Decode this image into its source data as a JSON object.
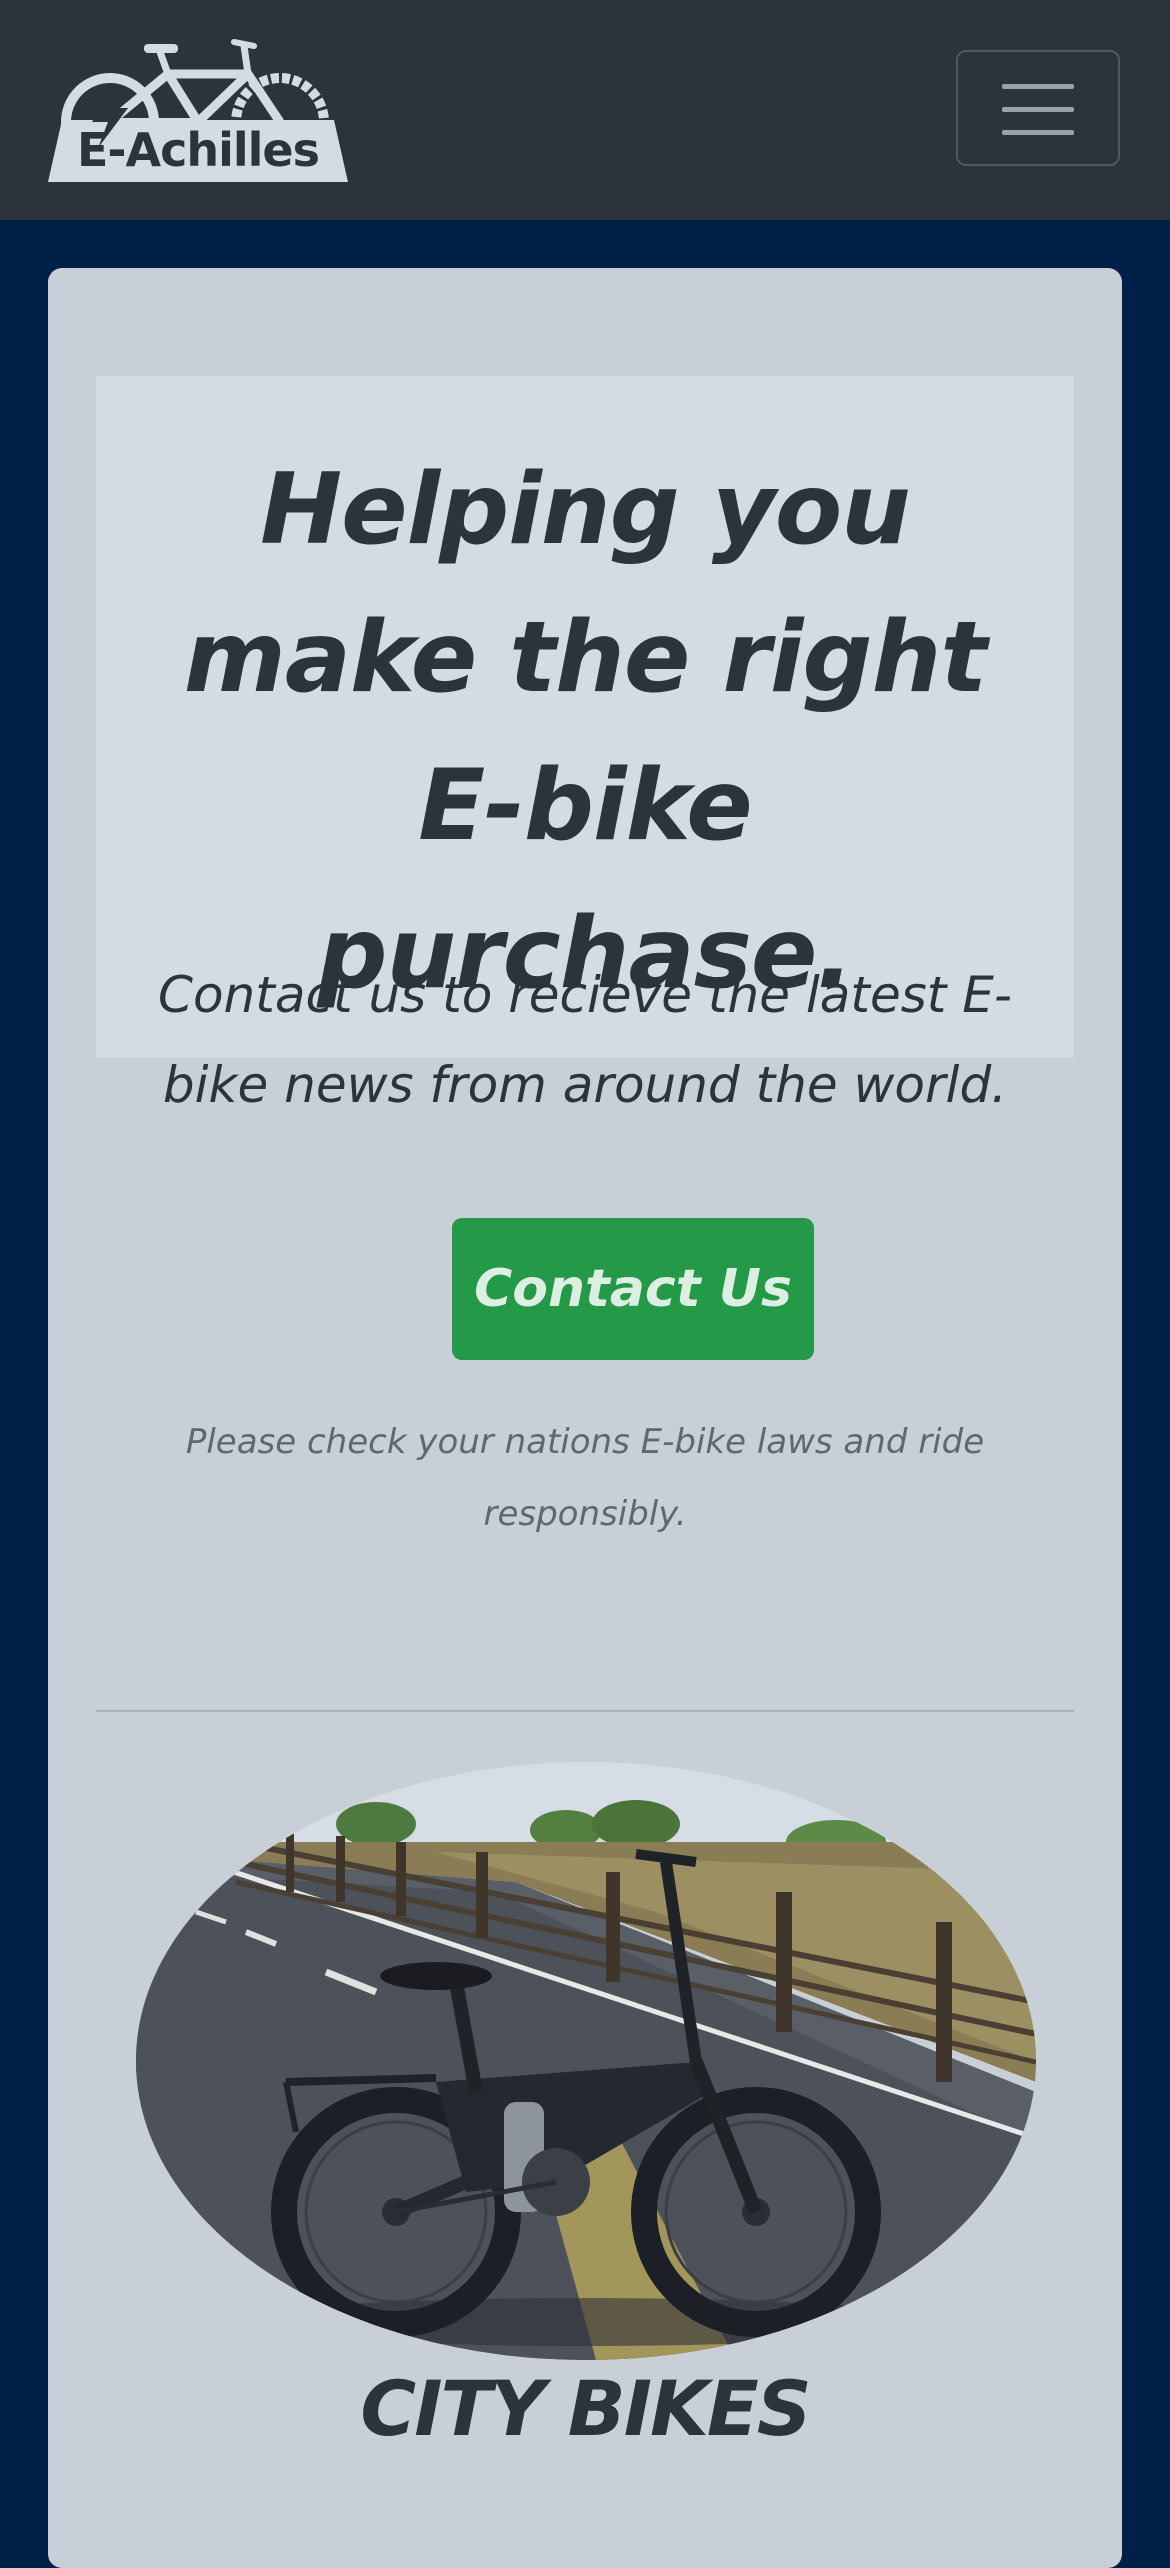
{
  "header": {
    "logo_text": "E-Achilles"
  },
  "hero": {
    "title": "Helping you make the right E-bike purchase.",
    "lead": "Contact us to recieve the latest E-bike news from around the world.",
    "contact_button": "Contact Us",
    "disclaimer": "Please check your nations E-bike laws and ride responsibly."
  },
  "section": {
    "title": "CITY BIKES"
  },
  "colors": {
    "navbar": "#2b333d",
    "page_background": "#00204a",
    "card": "#c9cfd6",
    "jumbotron": "#d4dbe3",
    "button_green": "#249947",
    "text_dark": "#2b333d"
  },
  "icons": {
    "menu": "hamburger-menu-icon",
    "logo": "electric-bike-logo"
  }
}
